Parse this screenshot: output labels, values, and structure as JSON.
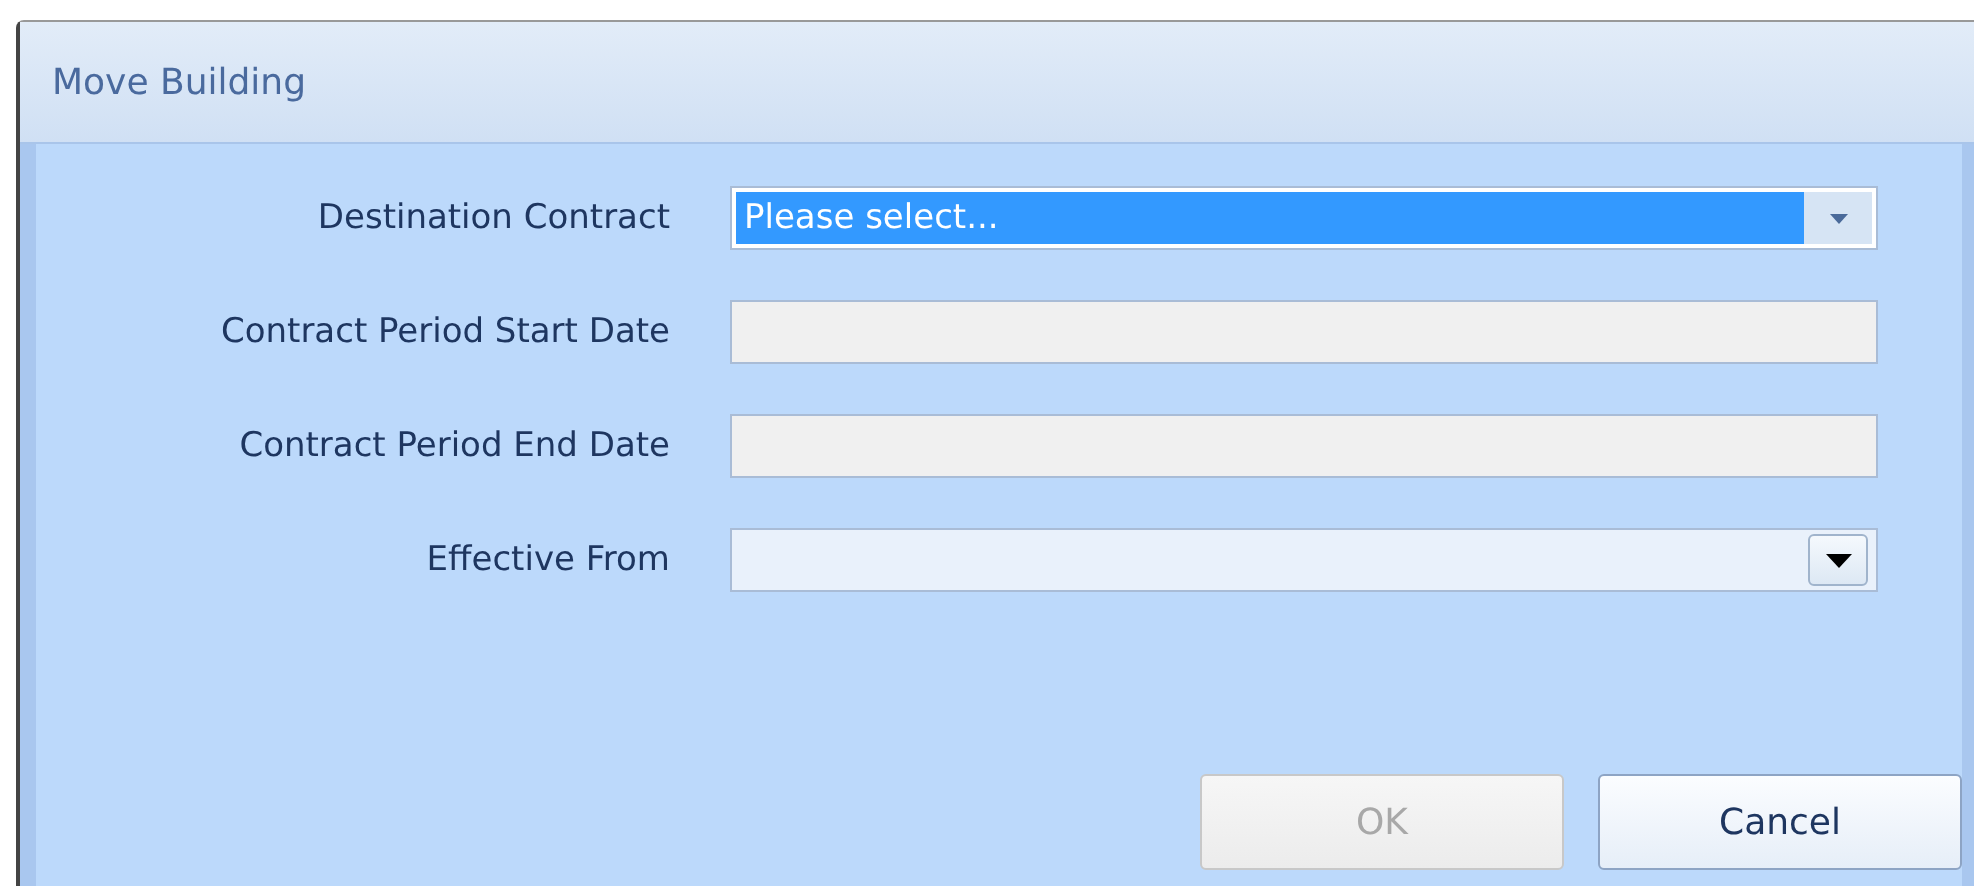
{
  "window": {
    "title": "Move Building"
  },
  "fields": [
    {
      "label": "Destination Contract",
      "kind": "combo",
      "value": "Please select...",
      "selected": true,
      "disabled": false
    },
    {
      "label": "Contract Period Start Date",
      "kind": "text",
      "disabled": true
    },
    {
      "label": "Contract Period End Date",
      "kind": "text",
      "disabled": true
    },
    {
      "label": "Effective From",
      "kind": "date",
      "disabled": false
    }
  ],
  "buttons": [
    {
      "label": "OK",
      "disabled": true
    },
    {
      "label": "Cancel",
      "disabled": false
    }
  ]
}
